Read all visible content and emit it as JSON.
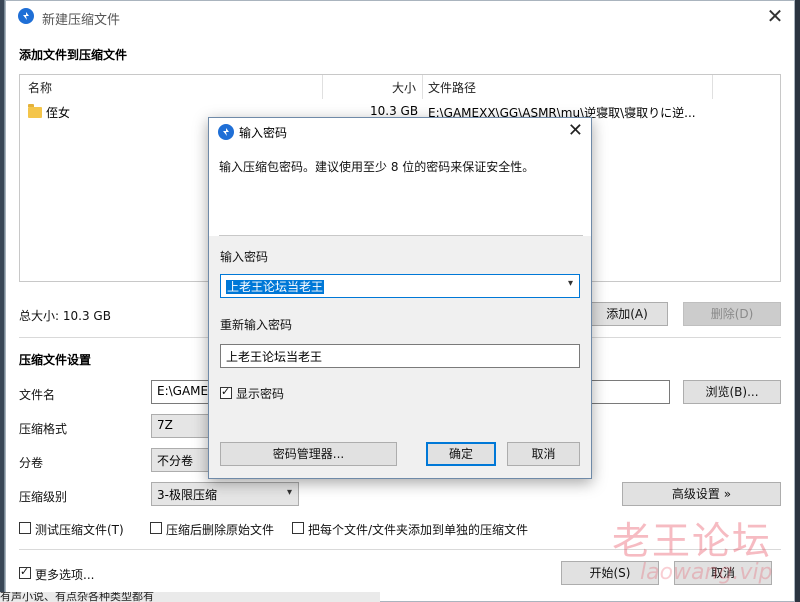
{
  "main_window": {
    "title": "新建压缩文件",
    "add_files_heading": "添加文件到压缩文件",
    "columns": {
      "name": "名称",
      "size": "大小",
      "path": "文件路径"
    },
    "files": [
      {
        "name": "侄女",
        "size": "10.3 GB",
        "path": "E:\\GAMEXX\\GG\\ASMR\\mu\\逆寝取\\寝取りに逆..."
      }
    ],
    "total_size": "总大小: 10.3 GB",
    "add_button": "添加(A)",
    "delete_button": "删除(D)",
    "settings_heading": "压缩文件设置",
    "filename_label": "文件名",
    "filename_value": "E:\\GAMEXX\\",
    "browse_button": "浏览(B)...",
    "format_label": "压缩格式",
    "format_value": "7Z",
    "split_label": "分卷",
    "split_value": "不分卷",
    "level_label": "压缩级别",
    "level_value": "3-极限压缩",
    "advanced_button": "高级设置 »",
    "test_checkbox": "测试压缩文件(T)",
    "delete_after_checkbox": "压缩后删除原始文件",
    "each_file_checkbox": "把每个文件/文件夹添加到单独的压缩文件",
    "more_options_checkbox": "更多选项...",
    "start_button": "开始(S)",
    "cancel_button": "取消"
  },
  "password_dialog": {
    "title": "输入密码",
    "description": "输入压缩包密码。建议使用至少 8 位的密码来保证安全性。",
    "password_label": "输入密码",
    "password_value": "上老王论坛当老王",
    "reenter_label": "重新输入密码",
    "reenter_value": "上老王论坛当老王",
    "show_password_checkbox": "显示密码",
    "manager_button": "密码管理器...",
    "ok_button": "确定",
    "cancel_button": "取消"
  },
  "watermark": {
    "text": "老王论坛",
    "url": "laowang.vip"
  },
  "background_text": "有声小说、有点杂各种类型都有",
  "colors": {
    "accent": "#0078d7",
    "app_icon": "#1f6fd6",
    "watermark": "#e63c50"
  }
}
